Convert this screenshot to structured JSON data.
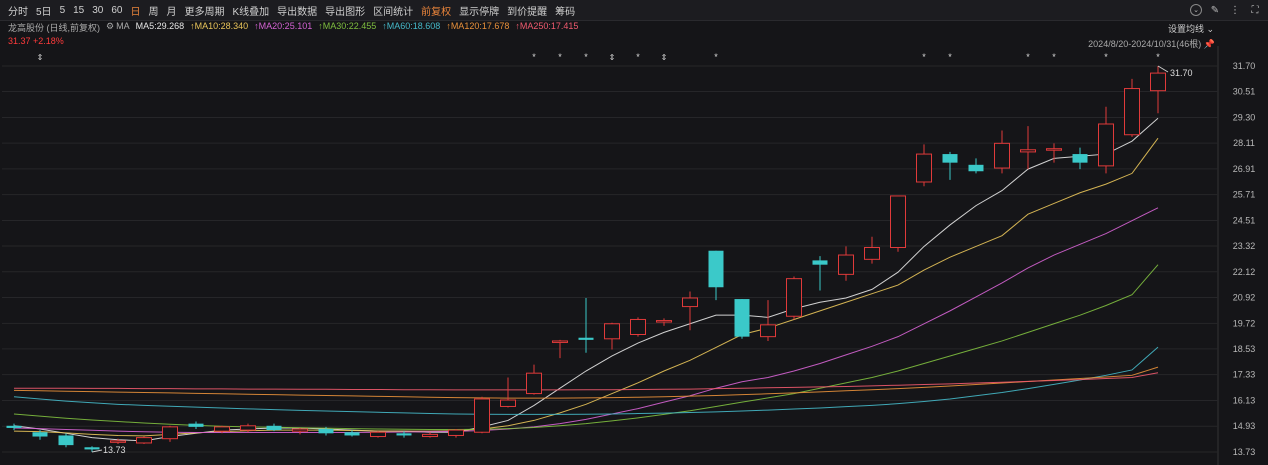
{
  "toolbar": {
    "periods": [
      "分时",
      "5日",
      "5",
      "15",
      "30",
      "60",
      "日",
      "周",
      "月",
      "更多周期",
      "K线叠加",
      "导出数据",
      "导出图形",
      "区间统计",
      "前复权",
      "显示停牌",
      "到价提醒",
      "筹码"
    ],
    "active_period": "日",
    "active_adjust": "前复权",
    "icons": [
      "chevron-circle-icon",
      "brush-icon",
      "settings-icon",
      "fullscreen-icon"
    ]
  },
  "header": {
    "stock_title": "龙高股份 (日线,前复权)",
    "ma_label": "MA",
    "ma_values": [
      {
        "label": "MA5:29.268",
        "color": "#e6e6e6"
      },
      {
        "label": "MA10:28.340",
        "color": "#e8c45a"
      },
      {
        "label": "MA20:25.101",
        "color": "#d563d3"
      },
      {
        "label": "MA30:22.455",
        "color": "#7fbf3f"
      },
      {
        "label": "MA60:18.608",
        "color": "#45b8c8"
      },
      {
        "label": "MA120:17.678",
        "color": "#e8903a"
      },
      {
        "label": "MA250:17.415",
        "color": "#f05a6e"
      }
    ],
    "last_price_text": "31.37 +2.18%",
    "setting_label": "设置均线",
    "range_text": "2024/8/20-2024/10/31(46根)"
  },
  "chart_data": {
    "type": "candlestick",
    "y_ticks": [
      "31.70",
      "30.51",
      "29.30",
      "28.11",
      "26.91",
      "25.71",
      "24.51",
      "23.32",
      "22.12",
      "20.92",
      "19.72",
      "18.53",
      "17.33",
      "16.13",
      "14.93",
      "13.73"
    ],
    "ylim": [
      13.73,
      31.7
    ],
    "candles": [
      {
        "o": 14.95,
        "h": 15.05,
        "l": 14.75,
        "c": 14.85
      },
      {
        "o": 14.65,
        "h": 14.75,
        "l": 14.3,
        "c": 14.45
      },
      {
        "o": 14.5,
        "h": 14.6,
        "l": 13.95,
        "c": 14.05
      },
      {
        "o": 13.95,
        "h": 14.0,
        "l": 13.73,
        "c": 13.85
      },
      {
        "o": 14.2,
        "h": 14.35,
        "l": 14.1,
        "c": 14.25
      },
      {
        "o": 14.15,
        "h": 14.45,
        "l": 14.1,
        "c": 14.4
      },
      {
        "o": 14.35,
        "h": 14.95,
        "l": 14.2,
        "c": 14.9
      },
      {
        "o": 15.05,
        "h": 15.15,
        "l": 14.8,
        "c": 14.9
      },
      {
        "o": 14.7,
        "h": 14.95,
        "l": 14.6,
        "c": 14.9
      },
      {
        "o": 14.75,
        "h": 15.05,
        "l": 14.65,
        "c": 14.95
      },
      {
        "o": 14.95,
        "h": 15.05,
        "l": 14.7,
        "c": 14.75
      },
      {
        "o": 14.7,
        "h": 14.85,
        "l": 14.55,
        "c": 14.8
      },
      {
        "o": 14.8,
        "h": 14.9,
        "l": 14.5,
        "c": 14.6
      },
      {
        "o": 14.65,
        "h": 14.75,
        "l": 14.45,
        "c": 14.5
      },
      {
        "o": 14.45,
        "h": 14.7,
        "l": 14.4,
        "c": 14.65
      },
      {
        "o": 14.6,
        "h": 14.7,
        "l": 14.4,
        "c": 14.5
      },
      {
        "o": 14.45,
        "h": 14.65,
        "l": 14.4,
        "c": 14.55
      },
      {
        "o": 14.5,
        "h": 14.8,
        "l": 14.4,
        "c": 14.75
      },
      {
        "o": 14.65,
        "h": 16.3,
        "l": 14.6,
        "c": 16.2
      },
      {
        "o": 15.85,
        "h": 17.2,
        "l": 15.8,
        "c": 16.15
      },
      {
        "o": 16.45,
        "h": 17.8,
        "l": 16.4,
        "c": 17.4
      },
      {
        "o": 18.9,
        "h": 18.95,
        "l": 18.1,
        "c": 18.9
      },
      {
        "o": 19.05,
        "h": 20.9,
        "l": 18.35,
        "c": 18.95
      },
      {
        "o": 19.0,
        "h": 19.75,
        "l": 18.5,
        "c": 19.7
      },
      {
        "o": 19.2,
        "h": 20.0,
        "l": 19.1,
        "c": 19.9
      },
      {
        "o": 19.85,
        "h": 19.95,
        "l": 19.6,
        "c": 19.85
      },
      {
        "o": 20.5,
        "h": 21.2,
        "l": 19.4,
        "c": 20.9
      },
      {
        "o": 23.1,
        "h": 23.1,
        "l": 20.8,
        "c": 21.4
      },
      {
        "o": 20.85,
        "h": 20.85,
        "l": 19.0,
        "c": 19.1
      },
      {
        "o": 19.1,
        "h": 20.8,
        "l": 18.9,
        "c": 19.65
      },
      {
        "o": 20.05,
        "h": 21.9,
        "l": 19.9,
        "c": 21.8
      },
      {
        "o": 22.65,
        "h": 22.85,
        "l": 21.25,
        "c": 22.45
      },
      {
        "o": 22.0,
        "h": 23.3,
        "l": 21.7,
        "c": 22.9
      },
      {
        "o": 22.7,
        "h": 23.75,
        "l": 22.5,
        "c": 23.25
      },
      {
        "o": 23.25,
        "h": 25.65,
        "l": 23.05,
        "c": 25.65
      },
      {
        "o": 26.3,
        "h": 28.05,
        "l": 26.1,
        "c": 27.6
      },
      {
        "o": 27.6,
        "h": 27.7,
        "l": 26.4,
        "c": 27.2
      },
      {
        "o": 27.1,
        "h": 27.4,
        "l": 26.7,
        "c": 26.8
      },
      {
        "o": 26.95,
        "h": 28.7,
        "l": 26.7,
        "c": 28.1
      },
      {
        "o": 27.7,
        "h": 28.9,
        "l": 26.9,
        "c": 27.8
      },
      {
        "o": 27.8,
        "h": 28.1,
        "l": 27.2,
        "c": 27.85
      },
      {
        "o": 27.6,
        "h": 27.9,
        "l": 26.9,
        "c": 27.2
      },
      {
        "o": 27.05,
        "h": 29.8,
        "l": 26.7,
        "c": 29.0
      },
      {
        "o": 28.5,
        "h": 31.1,
        "l": 28.4,
        "c": 30.65
      },
      {
        "o": 30.55,
        "h": 31.7,
        "l": 29.5,
        "c": 31.37
      }
    ],
    "ma_series": [
      {
        "name": "MA5",
        "color": "#e6e6e6",
        "values": [
          14.95,
          14.8,
          14.6,
          14.4,
          14.3,
          14.25,
          14.45,
          14.6,
          14.75,
          14.8,
          14.85,
          14.85,
          14.8,
          14.75,
          14.7,
          14.7,
          14.65,
          14.65,
          14.9,
          15.2,
          15.9,
          16.7,
          17.5,
          18.2,
          18.8,
          19.3,
          19.7,
          20.1,
          20.1,
          20.0,
          20.4,
          20.7,
          20.9,
          21.3,
          22.1,
          23.3,
          24.3,
          25.2,
          25.9,
          26.9,
          27.4,
          27.5,
          27.6,
          28.2,
          29.27
        ]
      },
      {
        "name": "MA10",
        "color": "#e8c45a",
        "values": [
          14.7,
          14.68,
          14.62,
          14.55,
          14.5,
          14.48,
          14.55,
          14.62,
          14.68,
          14.72,
          14.75,
          14.75,
          14.75,
          14.73,
          14.71,
          14.7,
          14.7,
          14.72,
          14.8,
          14.95,
          15.2,
          15.55,
          15.95,
          16.45,
          16.95,
          17.5,
          18.0,
          18.6,
          19.2,
          19.5,
          19.9,
          20.3,
          20.7,
          21.1,
          21.5,
          22.2,
          22.8,
          23.3,
          23.8,
          24.8,
          25.3,
          25.8,
          26.2,
          26.7,
          28.34
        ]
      },
      {
        "name": "MA20",
        "color": "#d563d3",
        "values": [
          14.85,
          14.82,
          14.78,
          14.74,
          14.7,
          14.67,
          14.65,
          14.64,
          14.64,
          14.64,
          14.64,
          14.64,
          14.64,
          14.64,
          14.65,
          14.66,
          14.67,
          14.69,
          14.73,
          14.8,
          14.9,
          15.05,
          15.25,
          15.5,
          15.75,
          16.05,
          16.35,
          16.7,
          17.0,
          17.2,
          17.5,
          17.85,
          18.25,
          18.65,
          19.1,
          19.7,
          20.3,
          20.95,
          21.6,
          22.3,
          22.9,
          23.4,
          23.9,
          24.5,
          25.1
        ]
      },
      {
        "name": "MA30",
        "color": "#7fbf3f",
        "values": [
          15.5,
          15.4,
          15.3,
          15.22,
          15.15,
          15.08,
          15.02,
          14.97,
          14.93,
          14.9,
          14.88,
          14.86,
          14.84,
          14.82,
          14.8,
          14.79,
          14.78,
          14.78,
          14.79,
          14.82,
          14.87,
          14.95,
          15.05,
          15.18,
          15.32,
          15.48,
          15.65,
          15.85,
          16.05,
          16.25,
          16.45,
          16.7,
          16.95,
          17.2,
          17.5,
          17.85,
          18.2,
          18.55,
          18.9,
          19.3,
          19.7,
          20.1,
          20.55,
          21.05,
          22.45
        ]
      },
      {
        "name": "MA60",
        "color": "#45b8c8",
        "values": [
          16.3,
          16.2,
          16.1,
          16.02,
          15.95,
          15.9,
          15.86,
          15.82,
          15.78,
          15.74,
          15.7,
          15.67,
          15.64,
          15.61,
          15.58,
          15.55,
          15.52,
          15.5,
          15.49,
          15.48,
          15.48,
          15.48,
          15.49,
          15.5,
          15.52,
          15.54,
          15.57,
          15.6,
          15.64,
          15.68,
          15.73,
          15.78,
          15.84,
          15.9,
          15.98,
          16.08,
          16.2,
          16.35,
          16.5,
          16.68,
          16.88,
          17.08,
          17.3,
          17.55,
          18.61
        ]
      },
      {
        "name": "MA120",
        "color": "#e8903a",
        "values": [
          16.6,
          16.58,
          16.56,
          16.54,
          16.52,
          16.5,
          16.48,
          16.46,
          16.44,
          16.42,
          16.4,
          16.38,
          16.36,
          16.34,
          16.32,
          16.3,
          16.28,
          16.26,
          16.25,
          16.24,
          16.24,
          16.24,
          16.25,
          16.26,
          16.28,
          16.3,
          16.33,
          16.36,
          16.4,
          16.44,
          16.48,
          16.53,
          16.58,
          16.63,
          16.68,
          16.74,
          16.8,
          16.87,
          16.94,
          17.01,
          17.08,
          17.15,
          17.22,
          17.3,
          17.68
        ]
      },
      {
        "name": "MA250",
        "color": "#f05a6e",
        "values": [
          16.7,
          16.7,
          16.7,
          16.69,
          16.69,
          16.68,
          16.68,
          16.67,
          16.67,
          16.66,
          16.66,
          16.65,
          16.65,
          16.64,
          16.64,
          16.63,
          16.63,
          16.62,
          16.62,
          16.62,
          16.62,
          16.62,
          16.63,
          16.63,
          16.64,
          16.65,
          16.66,
          16.68,
          16.7,
          16.72,
          16.74,
          16.76,
          16.78,
          16.81,
          16.84,
          16.87,
          16.9,
          16.94,
          16.98,
          17.02,
          17.06,
          17.1,
          17.15,
          17.2,
          17.42
        ]
      }
    ],
    "marks": {
      "star_indices": [
        20,
        21,
        22,
        24,
        27,
        35,
        36,
        39,
        40,
        42,
        44
      ],
      "arrow_indices": [
        1,
        23,
        25
      ],
      "low_label": "13.73",
      "high_label": "31.70"
    }
  }
}
